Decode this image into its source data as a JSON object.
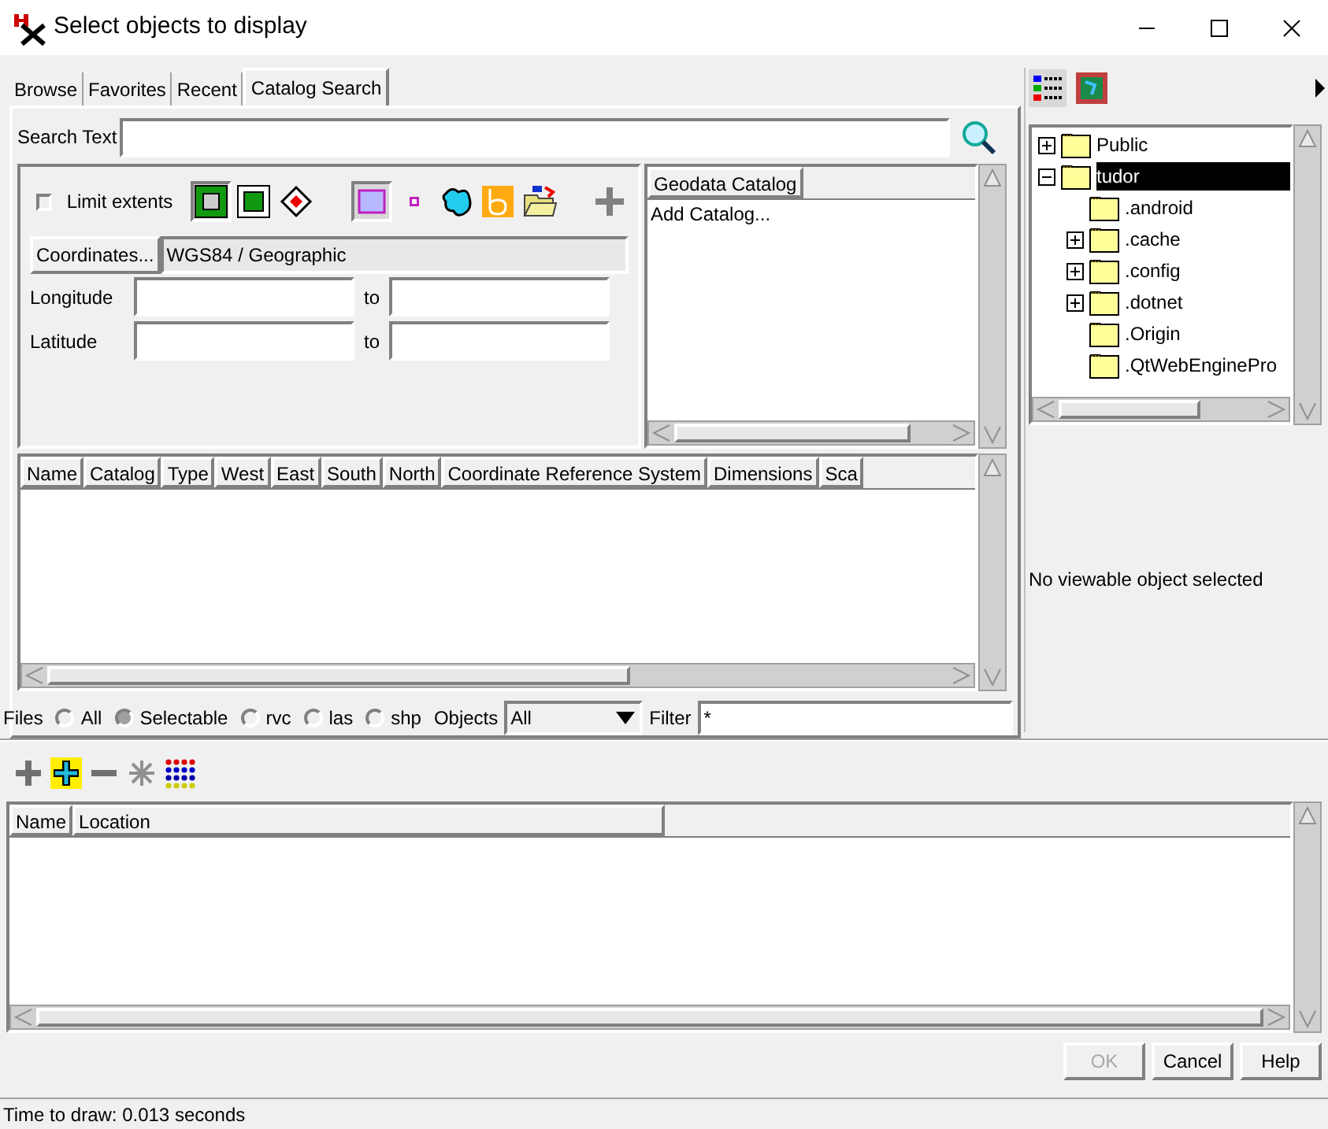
{
  "window": {
    "title": "Select objects to display"
  },
  "tabs": [
    {
      "label": "Browse",
      "selected": false
    },
    {
      "label": "Favorites",
      "selected": false
    },
    {
      "label": "Recent",
      "selected": false
    },
    {
      "label": "Catalog Search",
      "selected": true
    }
  ],
  "search": {
    "label": "Search Text"
  },
  "extents": {
    "limit_label": "Limit extents",
    "checked": false,
    "tools": [
      {
        "kind": "rect-outline",
        "pressed": true
      },
      {
        "kind": "rect-fill",
        "pressed": false
      },
      {
        "kind": "diamond",
        "pressed": false
      },
      {
        "kind": "lavender",
        "pressed": true
      },
      {
        "kind": "dot",
        "pressed": false
      },
      {
        "kind": "blob",
        "pressed": false
      },
      {
        "kind": "orange",
        "pressed": false
      },
      {
        "kind": "folder",
        "pressed": false
      },
      {
        "kind": "plus",
        "pressed": false
      }
    ],
    "coordinates_button": "Coordinates...",
    "crs": "WGS84 / Geographic",
    "rows": [
      {
        "label": "Longitude",
        "to": "to"
      },
      {
        "label": "Latitude",
        "to": "to"
      }
    ]
  },
  "catalog": {
    "column": "Geodata Catalog",
    "items": [
      "Add Catalog..."
    ]
  },
  "results": {
    "columns": [
      "Name",
      "Catalog",
      "Type",
      "West",
      "East",
      "South",
      "North",
      "Coordinate Reference System",
      "Dimensions",
      "Sca"
    ]
  },
  "files": {
    "label": "Files",
    "options": [
      {
        "label": "All",
        "selected": false
      },
      {
        "label": "Selectable",
        "selected": true
      },
      {
        "label": "rvc",
        "selected": false
      },
      {
        "label": "las",
        "selected": false
      },
      {
        "label": "shp",
        "selected": false
      }
    ],
    "objects_label": "Objects",
    "objects_value": "All",
    "filter_label": "Filter",
    "filter_value": "*"
  },
  "tree": [
    {
      "label": "Public",
      "expandable": true,
      "expanded": false,
      "selected": false
    },
    {
      "label": "tudor",
      "expandable": true,
      "expanded": true,
      "selected": true,
      "children": [
        {
          "label": ".android",
          "expandable": false,
          "selected": false
        },
        {
          "label": ".cache",
          "expandable": true,
          "expanded": false,
          "selected": false
        },
        {
          "label": ".config",
          "expandable": true,
          "expanded": false,
          "selected": false
        },
        {
          "label": ".dotnet",
          "expandable": true,
          "expanded": false,
          "selected": false
        },
        {
          "label": ".Origin",
          "expandable": false,
          "selected": false
        },
        {
          "label": ".QtWebEnginePro",
          "expandable": false,
          "selected": false
        }
      ]
    }
  ],
  "preview": {
    "message": "No viewable object selected"
  },
  "list": {
    "columns": [
      "Name",
      "Location"
    ]
  },
  "buttons": [
    {
      "label": "OK",
      "disabled": true
    },
    {
      "label": "Cancel",
      "disabled": false
    },
    {
      "label": "Help",
      "disabled": false
    }
  ],
  "status_bar": "Time to draw: 0.013 seconds"
}
